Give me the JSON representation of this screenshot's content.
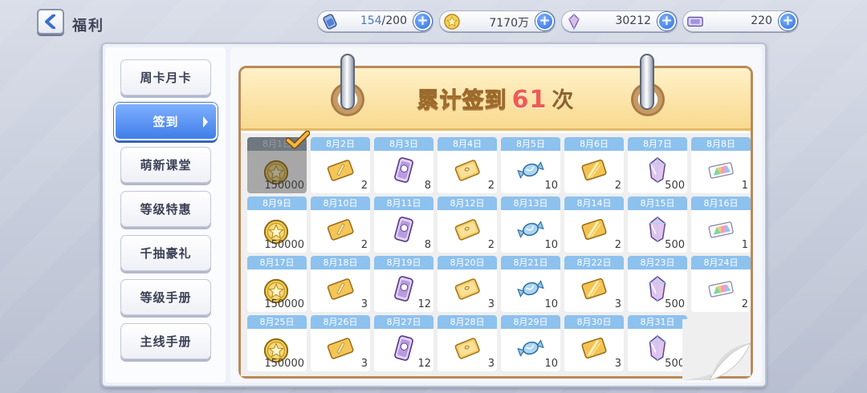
{
  "header": {
    "title": "福利",
    "resources": [
      {
        "icon": "stamina-potion-icon",
        "current": "154",
        "max": "/200"
      },
      {
        "icon": "gold-coin-icon",
        "value": "7170万"
      },
      {
        "icon": "jewel-icon",
        "value": "30212"
      },
      {
        "icon": "ticket-icon",
        "value": "220"
      }
    ],
    "plus_label": "+"
  },
  "sidebar": {
    "items": [
      {
        "label": "周卡月卡",
        "active": false
      },
      {
        "label": "签到",
        "active": true
      },
      {
        "label": "萌新课堂",
        "active": false
      },
      {
        "label": "等级特惠",
        "active": false
      },
      {
        "label": "千抽豪礼",
        "active": false
      },
      {
        "label": "等级手册",
        "active": false
      },
      {
        "label": "主线手册",
        "active": false
      }
    ]
  },
  "calendar": {
    "title_prefix": "累计签到",
    "count": "61",
    "title_suffix": "次",
    "days": [
      {
        "date": "8月1日",
        "item": "coin",
        "qty": "150000",
        "claimed": true
      },
      {
        "date": "8月2日",
        "item": "ticket",
        "qty": "2"
      },
      {
        "date": "8月3日",
        "item": "scroll",
        "qty": "8"
      },
      {
        "date": "8月4日",
        "item": "card",
        "qty": "2"
      },
      {
        "date": "8月5日",
        "item": "candy",
        "qty": "10"
      },
      {
        "date": "8月6日",
        "item": "feather-card",
        "qty": "2"
      },
      {
        "date": "8月7日",
        "item": "jewel",
        "qty": "500"
      },
      {
        "date": "8月8日",
        "item": "rainbow-ticket",
        "qty": "1"
      },
      {
        "date": "8月9日",
        "item": "coin",
        "qty": "150000"
      },
      {
        "date": "8月10日",
        "item": "ticket",
        "qty": "2"
      },
      {
        "date": "8月11日",
        "item": "scroll",
        "qty": "8"
      },
      {
        "date": "8月12日",
        "item": "card",
        "qty": "2"
      },
      {
        "date": "8月13日",
        "item": "candy",
        "qty": "10"
      },
      {
        "date": "8月14日",
        "item": "feather-card",
        "qty": "2"
      },
      {
        "date": "8月15日",
        "item": "jewel",
        "qty": "500"
      },
      {
        "date": "8月16日",
        "item": "rainbow-ticket",
        "qty": "1"
      },
      {
        "date": "8月17日",
        "item": "coin",
        "qty": "150000"
      },
      {
        "date": "8月18日",
        "item": "ticket",
        "qty": "3"
      },
      {
        "date": "8月19日",
        "item": "scroll",
        "qty": "12"
      },
      {
        "date": "8月20日",
        "item": "card",
        "qty": "3"
      },
      {
        "date": "8月21日",
        "item": "candy",
        "qty": "10"
      },
      {
        "date": "8月22日",
        "item": "feather-card",
        "qty": "3"
      },
      {
        "date": "8月23日",
        "item": "jewel",
        "qty": "500"
      },
      {
        "date": "8月24日",
        "item": "rainbow-ticket",
        "qty": "2"
      },
      {
        "date": "8月25日",
        "item": "coin",
        "qty": "150000"
      },
      {
        "date": "8月26日",
        "item": "ticket",
        "qty": "3"
      },
      {
        "date": "8月27日",
        "item": "scroll",
        "qty": "12"
      },
      {
        "date": "8月28日",
        "item": "card",
        "qty": "3"
      },
      {
        "date": "8月29日",
        "item": "candy",
        "qty": "10"
      },
      {
        "date": "8月30日",
        "item": "feather-card",
        "qty": "3"
      },
      {
        "date": "8月31日",
        "item": "jewel",
        "qty": "500"
      }
    ]
  },
  "colors": {
    "accent_blue": "#3f7ee8",
    "date_strip": "#8dc1ee",
    "title_count": "#ef5b55",
    "calendar_border": "#b98a5a"
  }
}
